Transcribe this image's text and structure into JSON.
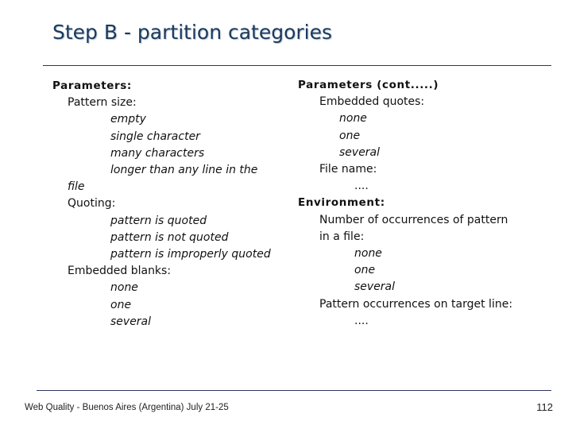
{
  "slide": {
    "title": "Step B - partition categories",
    "left_column": {
      "heading": "Parameters:",
      "groups": [
        {
          "label": "Pattern size:",
          "items": [
            "empty",
            "single character",
            "many characters",
            "longer than any line in the"
          ],
          "wrap": "file"
        },
        {
          "label": "Quoting:",
          "items": [
            "pattern is quoted",
            "pattern is not quoted",
            "pattern is improperly quoted"
          ]
        },
        {
          "label": "Embedded blanks:",
          "items": [
            "none",
            "one",
            "several"
          ]
        }
      ]
    },
    "right_column": {
      "heading": "Parameters (cont.....)",
      "groups": [
        {
          "label": "Embedded quotes:",
          "items": [
            "none",
            "one",
            "several"
          ]
        },
        {
          "label": "File name:",
          "items": [
            "...."
          ]
        }
      ],
      "heading2": "Environment:",
      "env_groups": [
        {
          "label_line1": "Number of occurrences of pattern",
          "label_line2": "in a file:",
          "items": [
            "none",
            "one",
            "several"
          ]
        },
        {
          "label": "Pattern occurrences on target line:",
          "items": [
            "...."
          ]
        }
      ]
    },
    "footer": {
      "left": "Web Quality - Buenos Aires (Argentina) July 21-25",
      "page_number": "112"
    }
  }
}
